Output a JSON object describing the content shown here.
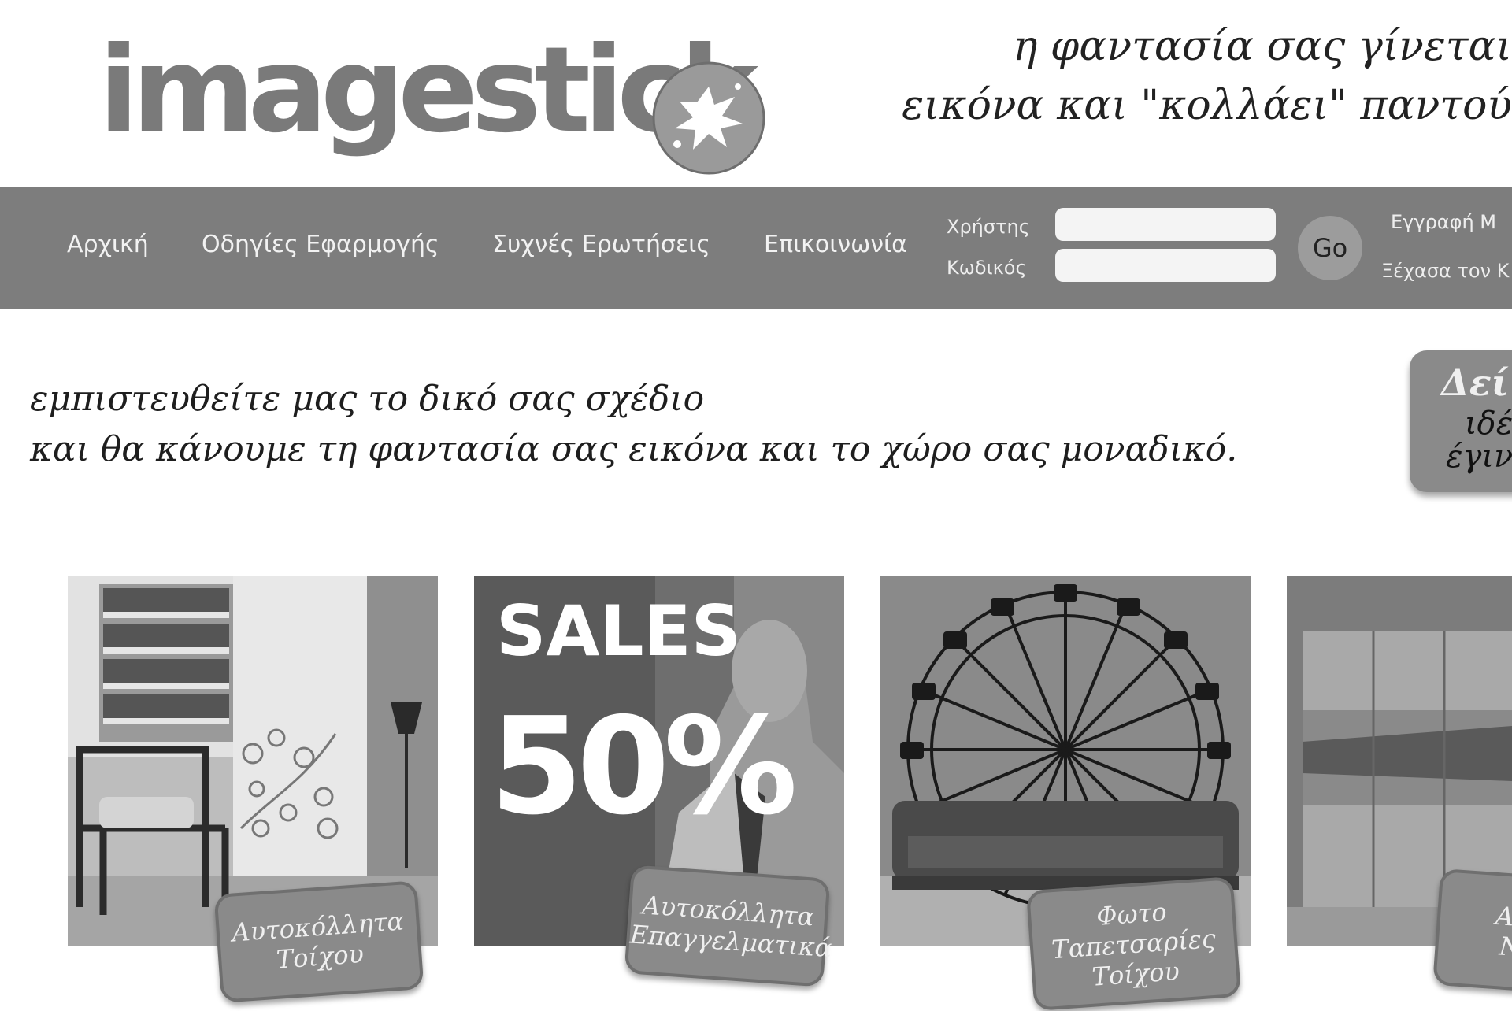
{
  "header": {
    "logo_text": "imagestick",
    "tagline": [
      "η φαντασία σας γίνεται",
      "εικόνα  και \"κολλάει\"  παντού"
    ]
  },
  "nav": {
    "items": [
      "Αρχική",
      "Οδηγίες Εφαρμογής",
      "Συχνές Ερωτήσεις",
      "Επικοινωνία"
    ],
    "login": {
      "user_label": "Χρήστης",
      "password_label": "Κωδικός",
      "user_value": "",
      "password_value": "",
      "go_label": "Go"
    },
    "register_link": "Εγγραφή Μ",
    "forgot_link": "Ξέχασα τον Κ"
  },
  "intro": {
    "lines": [
      "εμπιστευθείτε μας το δικό σας σχέδιο",
      "και θα κάνουμε τη φαντασία σας εικόνα και το χώρο σας μοναδικό."
    ]
  },
  "side_button": {
    "lines": [
      "Δεί",
      "ιδέ",
      "έγινα"
    ]
  },
  "tiles": [
    {
      "lines": [
        "Αυτοκόλλητα",
        "Τοίχου"
      ]
    },
    {
      "image_text": [
        "SALES",
        "50%"
      ],
      "lines": [
        "Αυτοκόλλητα",
        "Επαγγελματικά"
      ]
    },
    {
      "lines": [
        "Φωτο",
        "Ταπετσαρίες",
        "Τοίχου"
      ]
    },
    {
      "lines": [
        "Αυτ",
        "Ντ"
      ]
    }
  ],
  "colors": {
    "navbar": "#7d7d7d",
    "logo": "#7a7a7a",
    "badge": "#8a8a8a"
  }
}
